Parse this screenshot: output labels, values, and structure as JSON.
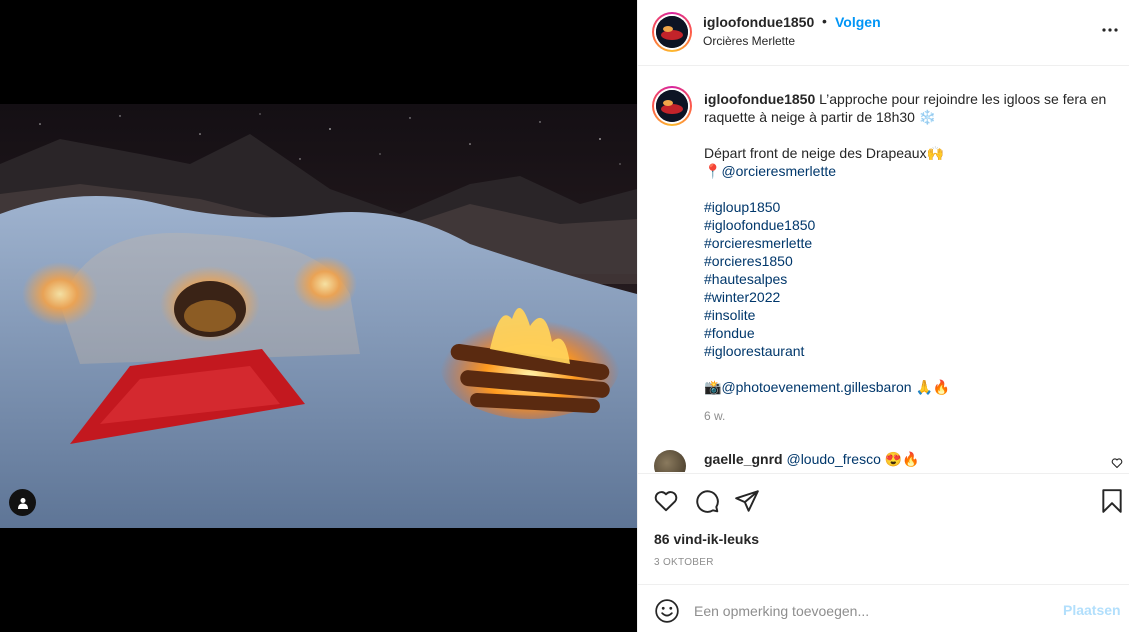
{
  "post": {
    "username": "igloofondue1850",
    "separator": "•",
    "follow_label": "Volgen",
    "location": "Orcières Merlette"
  },
  "caption": {
    "username": "igloofondue1850",
    "lines": [
      "L’approche pour rejoindre les igloos se fera en",
      "raquette à neige à partir de 18h30 ❄️",
      "",
      "Départ front de neige des Drapeaux🙌",
      "📍",
      "@orcieresmerlette",
      "",
      "#igloup1850",
      "#igloofondue1850",
      "#orcieresmerlette",
      "#orcieres1850",
      "#hautesalpes",
      "#winter2022",
      "#insolite",
      "#fondue",
      "#igloorestaurant",
      "",
      "📸",
      "@photoevenement.gillesbaron",
      " 🙏🔥"
    ],
    "time": "6 w."
  },
  "comment": {
    "username": "gaelle_gnrd",
    "mention": "@loudo_fresco",
    "emoji": " 😍🔥"
  },
  "actions": {
    "likes": "86 vind-ik-leuks",
    "date": "3 oktober"
  },
  "add_comment": {
    "placeholder": "Een opmerking toevoegen...",
    "post_label": "Plaatsen"
  },
  "colors": {
    "link": "#0095f6",
    "hashtag": "#00376b",
    "muted": "#8e8e8e",
    "post_disabled": "#b2dffc"
  }
}
